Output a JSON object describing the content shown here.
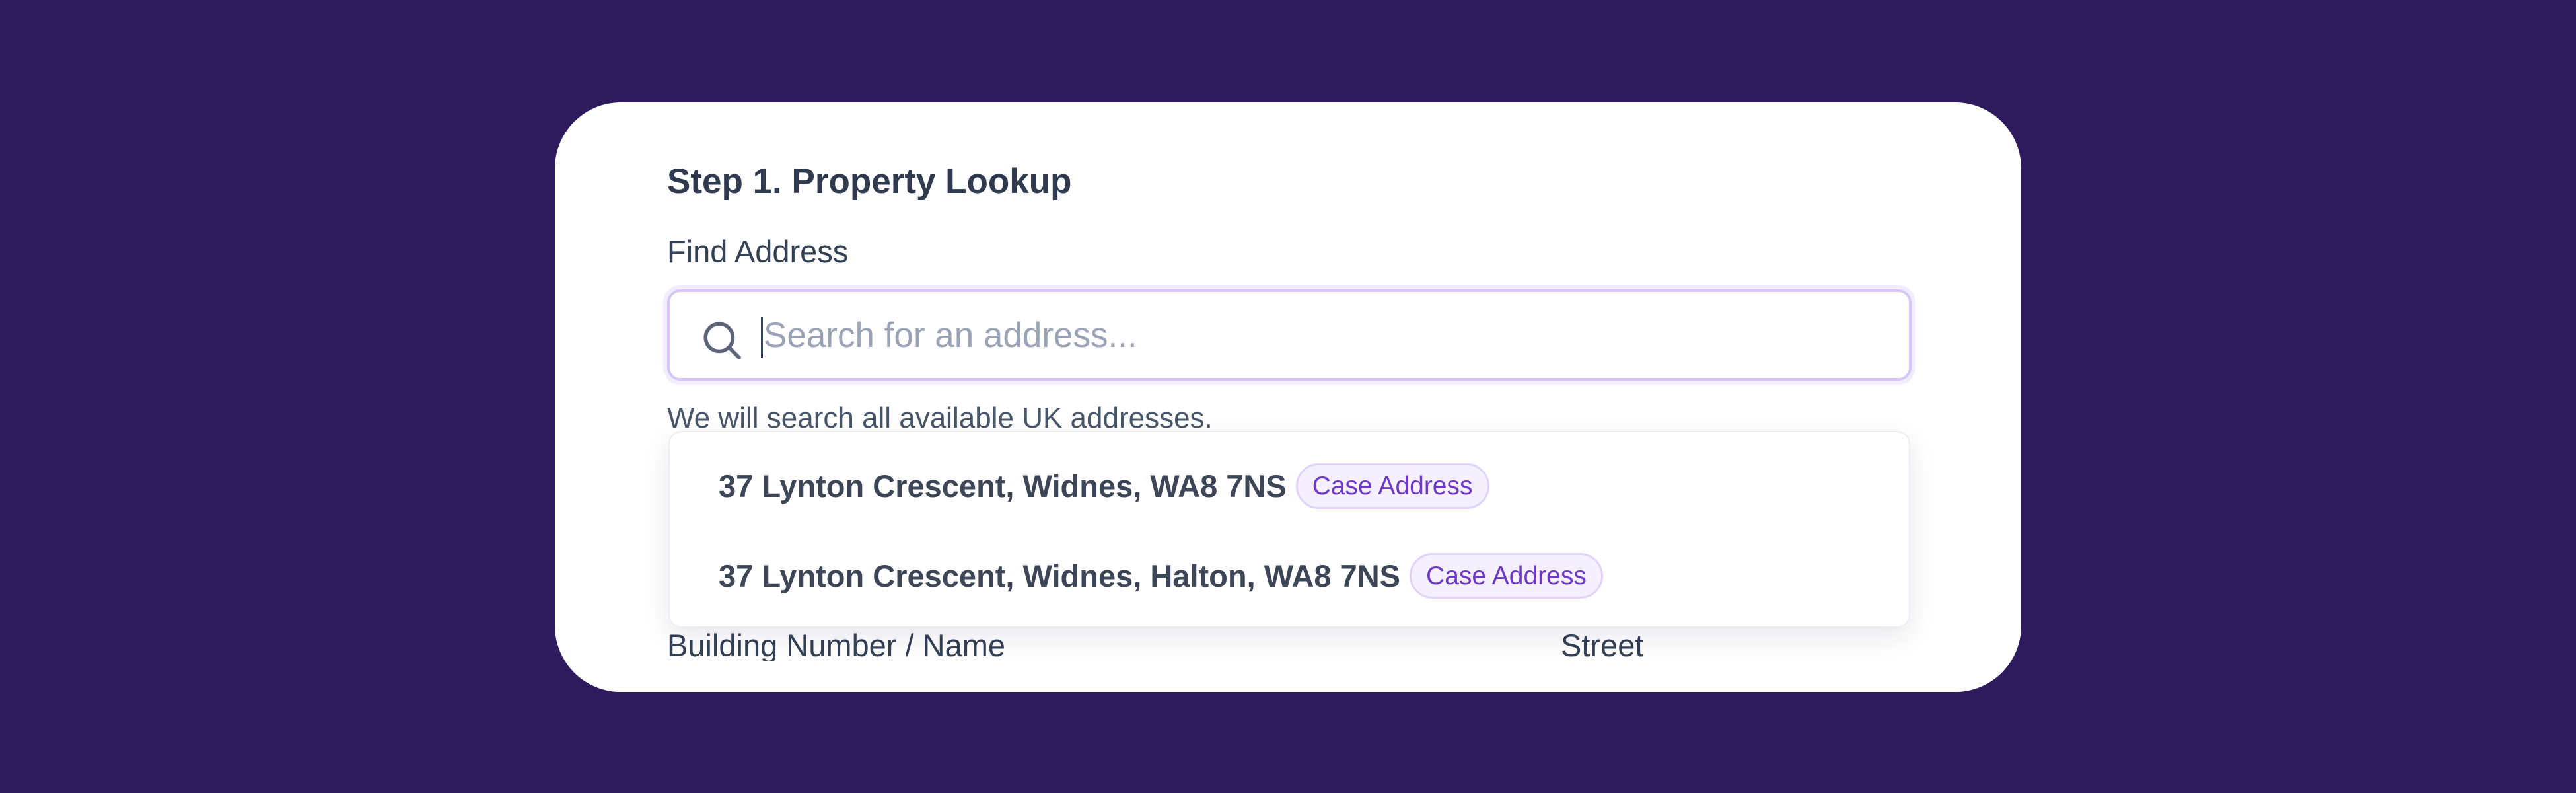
{
  "form": {
    "step_title": "Step 1. Property Lookup",
    "find_address_label": "Find Address",
    "search": {
      "placeholder": "Search for an address...",
      "value": "",
      "icon": "search-icon"
    },
    "hint": "We will search all available UK addresses.",
    "results": [
      {
        "address": "37 Lynton Crescent, Widnes, WA8 7NS",
        "badge": "Case Address"
      },
      {
        "address": "37 Lynton Crescent, Widnes, Halton, WA8 7NS",
        "badge": "Case Address"
      }
    ],
    "fields": {
      "building_label": "Building Number / Name",
      "street_label": "Street"
    }
  },
  "colors": {
    "background": "#2d1b5e",
    "card": "#ffffff",
    "accent": "#6d38c8",
    "badge_bg": "#f5f0ff",
    "input_border": "#d6c6f5"
  }
}
